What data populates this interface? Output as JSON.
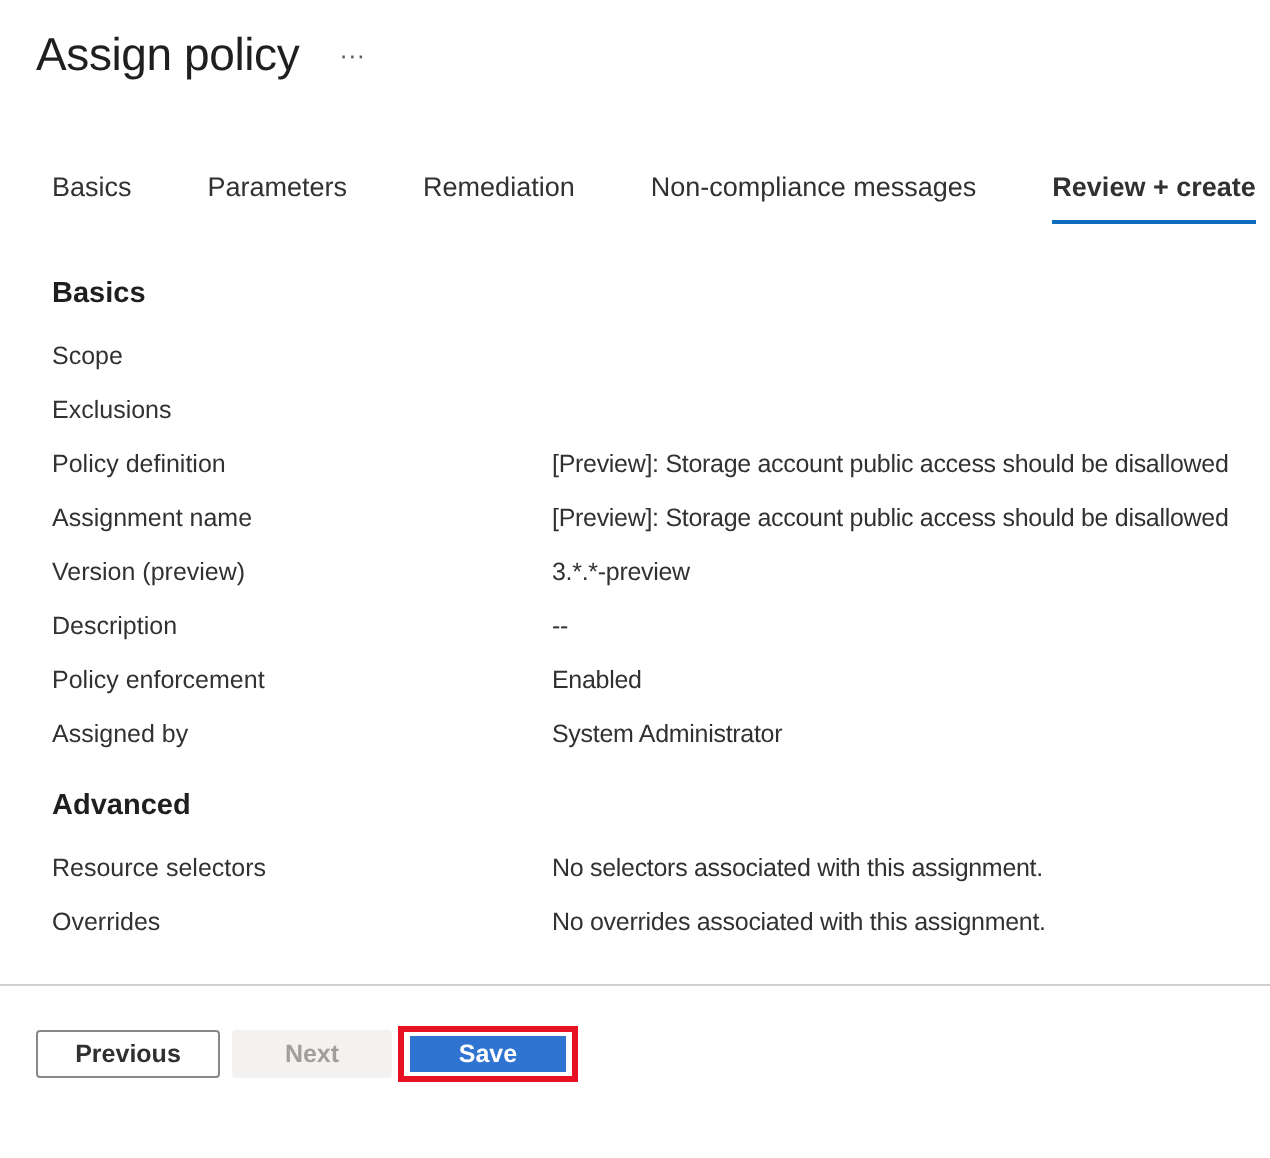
{
  "header": {
    "title": "Assign policy",
    "more": "···"
  },
  "tabs": [
    {
      "label": "Basics",
      "selected": false
    },
    {
      "label": "Parameters",
      "selected": false
    },
    {
      "label": "Remediation",
      "selected": false
    },
    {
      "label": "Non-compliance messages",
      "selected": false
    },
    {
      "label": "Review + create",
      "selected": true
    }
  ],
  "sections": [
    {
      "heading": "Basics",
      "rows": [
        {
          "label": "Scope"
        },
        {
          "label": "Exclusions"
        },
        {
          "label": "Policy definition",
          "value": "[Preview]: Storage account public access should be disallowed"
        },
        {
          "label": "Assignment name",
          "value": "[Preview]: Storage account public access should be disallowed"
        },
        {
          "label": "Version (preview)",
          "value": "3.*.*-preview"
        },
        {
          "label": "Description",
          "value": "--"
        },
        {
          "label": "Policy enforcement",
          "value": "Enabled"
        },
        {
          "label": "Assigned by",
          "value": "System Administrator"
        }
      ]
    },
    {
      "heading": "Advanced",
      "rows": [
        {
          "label": "Resource selectors",
          "value": "No selectors associated with this assignment."
        },
        {
          "label": "Overrides",
          "value": "No overrides associated with this assignment."
        }
      ]
    }
  ],
  "buttons": [
    {
      "label": "Previous",
      "kind": "secondary",
      "disabled": false,
      "highlighted": false
    },
    {
      "label": "Next",
      "kind": "secondary",
      "disabled": true,
      "highlighted": false
    },
    {
      "label": "Save",
      "kind": "primary",
      "disabled": false,
      "highlighted": true
    }
  ]
}
